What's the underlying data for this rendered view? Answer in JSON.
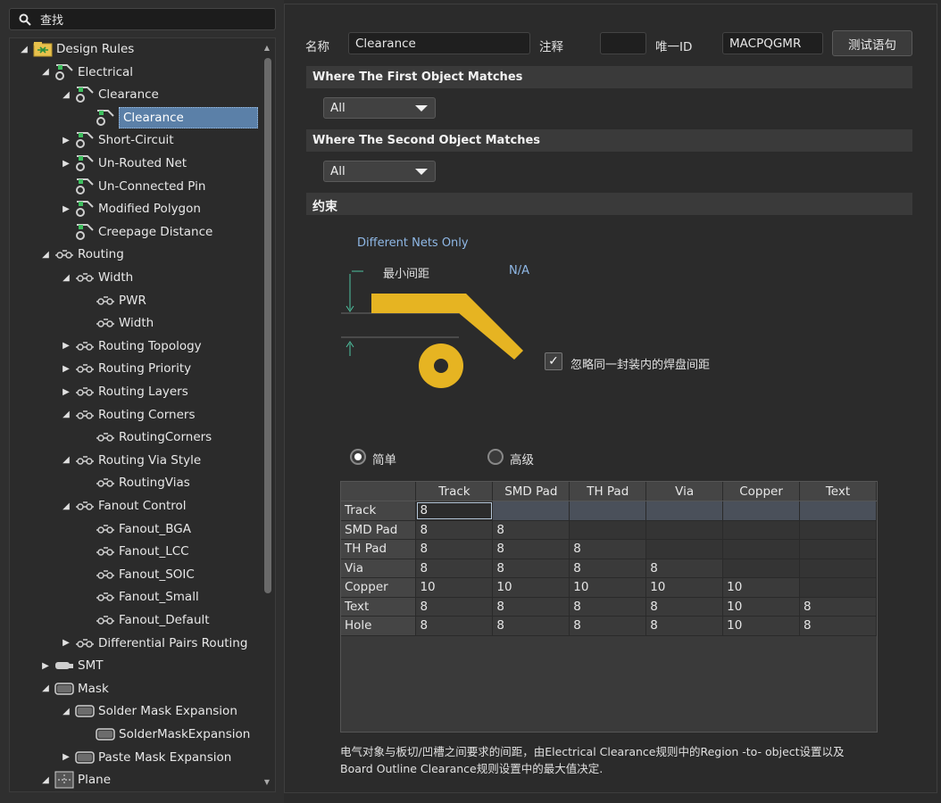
{
  "search": {
    "text": "查找"
  },
  "tree": [
    {
      "label": "Design Rules",
      "arrow": "down",
      "indent": 0,
      "icon": "design-rules-icon"
    },
    {
      "label": "Electrical",
      "arrow": "down",
      "indent": 1,
      "icon": "electrical-rule-icon"
    },
    {
      "label": "Clearance",
      "arrow": "down",
      "indent": 2,
      "icon": "electrical-rule-icon"
    },
    {
      "label": "Clearance",
      "arrow": "",
      "indent": 3,
      "icon": "electrical-rule-icon",
      "selected": true
    },
    {
      "label": "Short-Circuit",
      "arrow": "right",
      "indent": 2,
      "icon": "electrical-rule-icon"
    },
    {
      "label": "Un-Routed Net",
      "arrow": "right",
      "indent": 2,
      "icon": "electrical-rule-icon"
    },
    {
      "label": "Un-Connected Pin",
      "arrow": "",
      "indent": 2,
      "icon": "electrical-rule-icon"
    },
    {
      "label": "Modified Polygon",
      "arrow": "right",
      "indent": 2,
      "icon": "electrical-rule-icon"
    },
    {
      "label": "Creepage Distance",
      "arrow": "",
      "indent": 2,
      "icon": "electrical-rule-icon"
    },
    {
      "label": "Routing",
      "arrow": "down",
      "indent": 1,
      "icon": "routing-rule-icon"
    },
    {
      "label": "Width",
      "arrow": "down",
      "indent": 2,
      "icon": "routing-rule-icon"
    },
    {
      "label": "PWR",
      "arrow": "",
      "indent": 3,
      "icon": "routing-rule-icon"
    },
    {
      "label": "Width",
      "arrow": "",
      "indent": 3,
      "icon": "routing-rule-icon"
    },
    {
      "label": "Routing Topology",
      "arrow": "right",
      "indent": 2,
      "icon": "routing-rule-icon"
    },
    {
      "label": "Routing Priority",
      "arrow": "right",
      "indent": 2,
      "icon": "routing-rule-icon"
    },
    {
      "label": "Routing Layers",
      "arrow": "right",
      "indent": 2,
      "icon": "routing-rule-icon"
    },
    {
      "label": "Routing Corners",
      "arrow": "down",
      "indent": 2,
      "icon": "routing-rule-icon"
    },
    {
      "label": "RoutingCorners",
      "arrow": "",
      "indent": 3,
      "icon": "routing-rule-icon"
    },
    {
      "label": "Routing Via Style",
      "arrow": "down",
      "indent": 2,
      "icon": "routing-rule-icon"
    },
    {
      "label": "RoutingVias",
      "arrow": "",
      "indent": 3,
      "icon": "routing-rule-icon"
    },
    {
      "label": "Fanout Control",
      "arrow": "down",
      "indent": 2,
      "icon": "routing-rule-icon"
    },
    {
      "label": "Fanout_BGA",
      "arrow": "",
      "indent": 3,
      "icon": "routing-rule-icon"
    },
    {
      "label": "Fanout_LCC",
      "arrow": "",
      "indent": 3,
      "icon": "routing-rule-icon"
    },
    {
      "label": "Fanout_SOIC",
      "arrow": "",
      "indent": 3,
      "icon": "routing-rule-icon"
    },
    {
      "label": "Fanout_Small",
      "arrow": "",
      "indent": 3,
      "icon": "routing-rule-icon"
    },
    {
      "label": "Fanout_Default",
      "arrow": "",
      "indent": 3,
      "icon": "routing-rule-icon"
    },
    {
      "label": "Differential Pairs Routing",
      "arrow": "right",
      "indent": 2,
      "icon": "routing-rule-icon"
    },
    {
      "label": "SMT",
      "arrow": "right",
      "indent": 1,
      "icon": "smt-rule-icon"
    },
    {
      "label": "Mask",
      "arrow": "down",
      "indent": 1,
      "icon": "mask-rule-icon"
    },
    {
      "label": "Solder Mask Expansion",
      "arrow": "down",
      "indent": 2,
      "icon": "mask-rule-icon"
    },
    {
      "label": "SolderMaskExpansion",
      "arrow": "",
      "indent": 3,
      "icon": "mask-rule-icon"
    },
    {
      "label": "Paste Mask Expansion",
      "arrow": "right",
      "indent": 2,
      "icon": "mask-rule-icon"
    },
    {
      "label": "Plane",
      "arrow": "down",
      "indent": 1,
      "icon": "plane-rule-icon"
    }
  ],
  "form": {
    "name_label": "名称",
    "name_value": "Clearance",
    "comment_label": "注释",
    "comment_value": "",
    "uid_label": "唯一ID",
    "uid_value": "MACPQGMR",
    "test_button": "测试语句"
  },
  "first_match": {
    "title": "Where The First Object Matches",
    "value": "All"
  },
  "second_match": {
    "title": "Where The Second Object Matches",
    "value": "All"
  },
  "constraints": {
    "title": "约束",
    "nets": "Different Nets Only",
    "min_label": "最小间距",
    "min_value": "N/A",
    "ignore_label": "忽略同一封装内的焊盘间距",
    "ignore_checked": true,
    "mode_simple": "简单",
    "mode_advanced": "高级",
    "mode_selected": "simple"
  },
  "matrix": {
    "columns": [
      "Track",
      "SMD Pad",
      "TH Pad",
      "Via",
      "Copper",
      "Text"
    ],
    "rows": [
      {
        "name": "Track",
        "values": [
          "8"
        ]
      },
      {
        "name": "SMD Pad",
        "values": [
          "8",
          "8"
        ]
      },
      {
        "name": "TH Pad",
        "values": [
          "8",
          "8",
          "8"
        ]
      },
      {
        "name": "Via",
        "values": [
          "8",
          "8",
          "8",
          "8"
        ]
      },
      {
        "name": "Copper",
        "values": [
          "10",
          "10",
          "10",
          "10",
          "10"
        ]
      },
      {
        "name": "Text",
        "values": [
          "8",
          "8",
          "8",
          "8",
          "10",
          "8"
        ]
      },
      {
        "name": "Hole",
        "values": [
          "8",
          "8",
          "8",
          "8",
          "10",
          "8"
        ]
      }
    ]
  },
  "note_line1": "电气对象与板切/凹槽之间要求的间距，由Electrical Clearance规则中的Region -to- object设置以及",
  "note_line2": "Board Outline Clearance规则设置中的最大值决定.",
  "colors": {
    "accent": "#5b80a8",
    "gold": "#e6b422",
    "dim_line": "#4fc3a0"
  }
}
